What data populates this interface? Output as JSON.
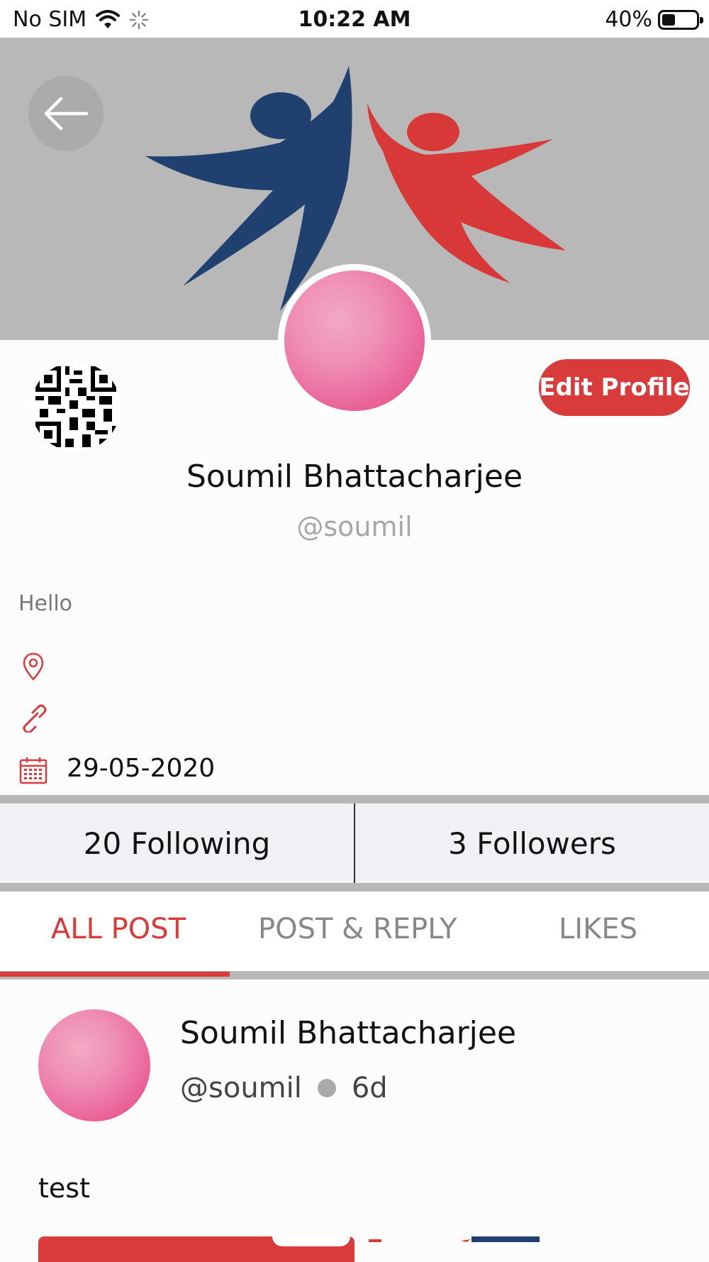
{
  "status_bar": {
    "carrier": "No SIM",
    "time": "10:22 AM",
    "battery_percent": "40%",
    "battery_level": 0.4
  },
  "profile": {
    "edit_label": "Edit Profile",
    "name": "Soumil Bhattacharjee",
    "handle": "@soumil",
    "bio": "Hello",
    "joined_date": "29-05-2020"
  },
  "stats": {
    "following": "20 Following",
    "followers": "3 Followers"
  },
  "tabs": [
    {
      "label": "ALL POST",
      "active": true
    },
    {
      "label": "POST & REPLY",
      "active": false
    },
    {
      "label": "LIKES",
      "active": false
    }
  ],
  "post": {
    "author": "Soumil Bhattacharjee",
    "handle": "@soumil",
    "age": "6d",
    "text": "test"
  },
  "colors": {
    "accent": "#d93a3a",
    "cover_bg": "#b8b8b8",
    "logo_blue": "#20406f",
    "logo_red": "#d93838"
  }
}
